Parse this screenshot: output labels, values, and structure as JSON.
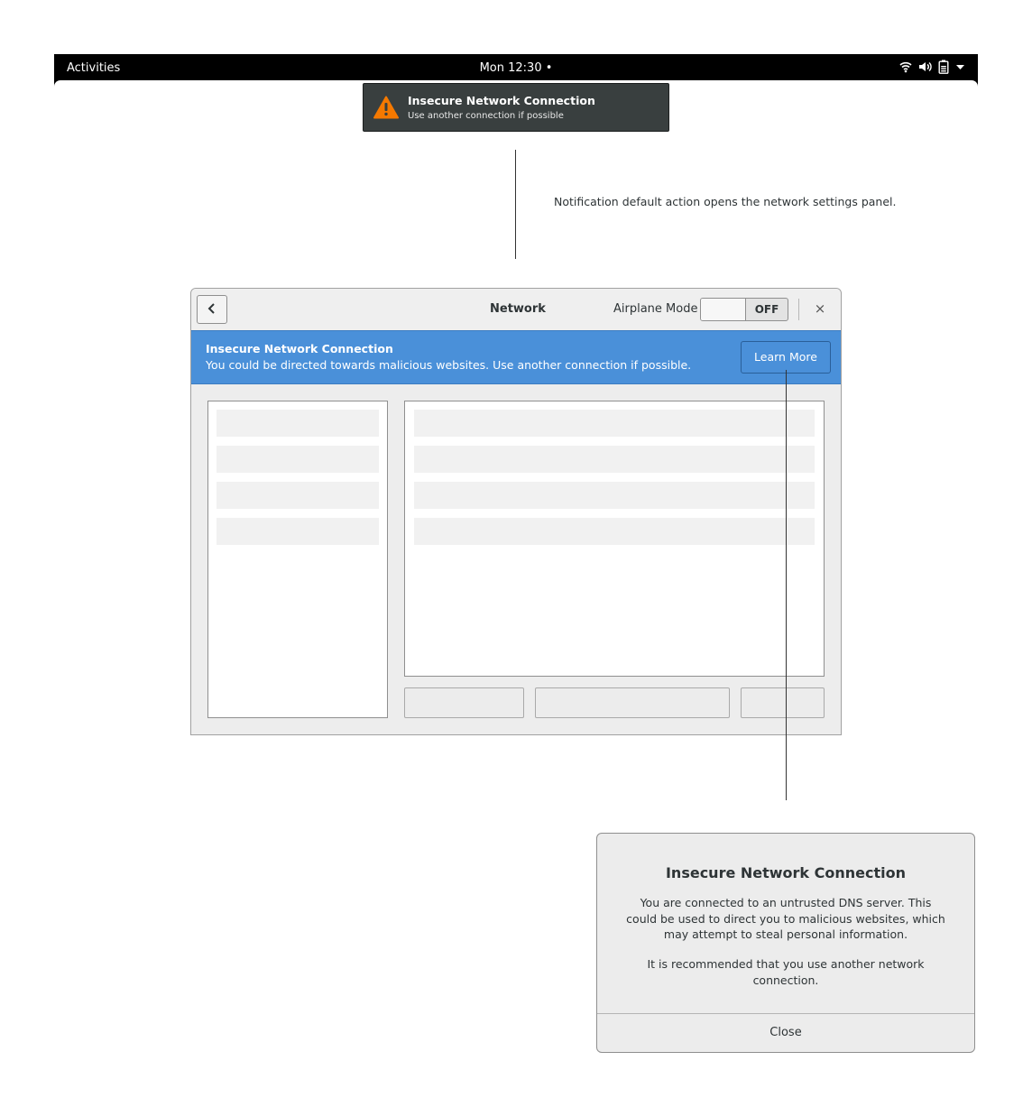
{
  "topbar": {
    "activities": "Activities",
    "clock": "Mon 12:30 •",
    "icons": [
      "wifi-icon",
      "volume-icon",
      "battery-icon",
      "menu-arrow-icon"
    ]
  },
  "notification": {
    "icon": "warning-icon",
    "title": "Insecure Network Connection",
    "body": "Use another connection if possible"
  },
  "annotation": {
    "text": "Notification default action opens the network settings panel."
  },
  "window": {
    "title": "Network",
    "back_icon": "back-chevron-icon",
    "airplane_mode_label": "Airplane Mode",
    "airplane_mode_state": "OFF",
    "close_icon": "×"
  },
  "infobar": {
    "title": "Insecure Network Connection",
    "body": "You could be directed towards malicious websites. Use another connection if possible.",
    "button": "Learn More",
    "background": "#4a90d9"
  },
  "dialog": {
    "title": "Insecure Network Connection",
    "paragraph1": "You are connected to an untrusted DNS server. This could be used to direct you to malicious websites, which may attempt to steal personal information.",
    "paragraph2": "It is recommended that you use another network connection.",
    "close": "Close"
  },
  "colors": {
    "warning": "#f57900",
    "accent": "#4a90d9"
  }
}
